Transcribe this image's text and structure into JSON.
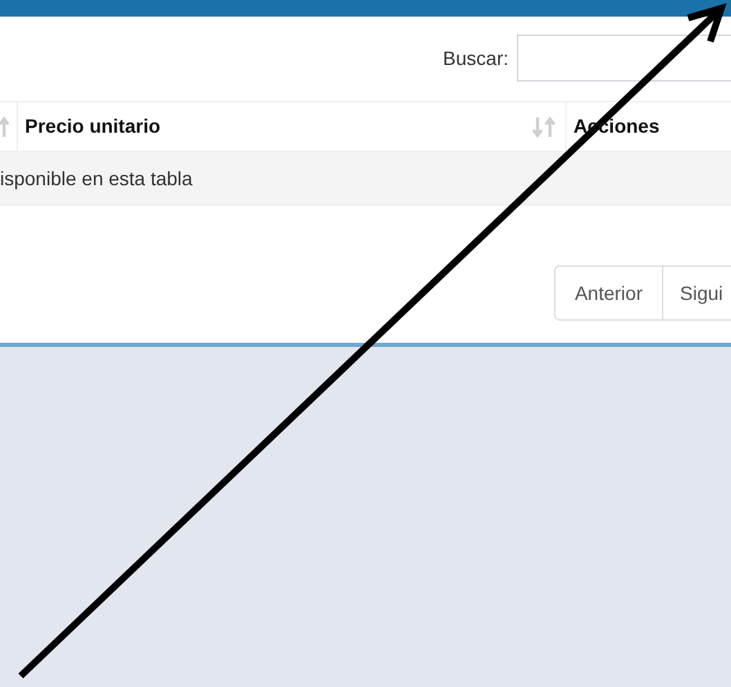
{
  "search": {
    "label": "Buscar:"
  },
  "table": {
    "columns": [
      {
        "sortable": true
      },
      {
        "label": "Precio unitario",
        "sortable": true
      },
      {
        "label": "Acciones",
        "sortable": false
      }
    ],
    "empty_message": "isponible en esta tabla"
  },
  "pagination": [
    {
      "label": "Anterior"
    },
    {
      "label": "Sigui"
    }
  ]
}
